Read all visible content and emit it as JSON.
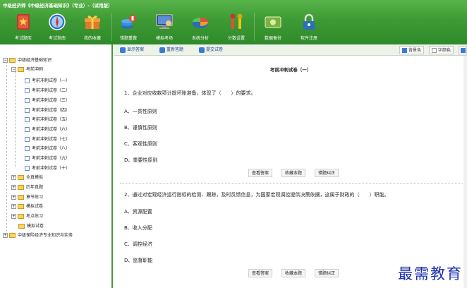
{
  "app": {
    "title": "中级经济师《中级经济基础知识》（专业）-（试用版）"
  },
  "toolbar": {
    "buttons": [
      {
        "label": "考试题库",
        "icon": "book-star-icon"
      },
      {
        "label": "考试指南",
        "icon": "compass-icon"
      },
      {
        "label": "我的收藏",
        "icon": "gift-icon"
      },
      {
        "label": "错题重做",
        "icon": "stack-icon"
      },
      {
        "label": "模拟考场",
        "icon": "computer-user-icon"
      },
      {
        "label": "系统分析",
        "icon": "pie-chart-icon"
      },
      {
        "label": "分数设置",
        "icon": "tools-icon"
      },
      {
        "label": "数据备份",
        "icon": "banknote-icon"
      },
      {
        "label": "软件注册",
        "icon": "lock-icon"
      }
    ]
  },
  "tree": {
    "root": "中级经济基础知识",
    "section": "考前冲刺",
    "papers": [
      "考前冲刺试卷（一）",
      "考前冲刺试卷（二）",
      "考前冲刺试卷（三）",
      "考前冲刺试卷（四）",
      "考前冲刺试卷（五）",
      "考前冲刺试卷（六）",
      "考前冲刺试卷（七）",
      "考前冲刺试卷（八）",
      "考前冲刺试卷（九）",
      "考前冲刺试卷（十）"
    ],
    "other_sections": [
      "全真模拟",
      "历年真题",
      "章节练习",
      "模拟试卷",
      "考点练习",
      "模拟试卷"
    ],
    "second_root": "中级保险经济专业知识与实务"
  },
  "main_toolbar": {
    "show_answer": "显示答案",
    "redo": "重新答题",
    "submit": "提交试卷",
    "bg_color": "背景色",
    "font_color": "字颜色"
  },
  "paper": {
    "title": "考前冲刺试卷（一）",
    "questions": [
      {
        "text": "1、企业对应收款项计提坏账准备，体现了（　　）的要求。",
        "options": [
          "A、一贯性原则",
          "B、谨慎性原则",
          "C、客观性原则",
          "D、重要性原则"
        ]
      },
      {
        "text": "2、通过对宏观经济运行指标的检测、跟踪，及时反馈信息，为国家宏观调控提供决策依据，这属于财政的（　　）职能。",
        "options": [
          "A、资源配置",
          "B、收入分配",
          "C、调控经济",
          "D、监督职能"
        ]
      }
    ],
    "actions": {
      "view_answer": "查看答案",
      "favorite": "收藏本题",
      "report_error": "错题纠正"
    }
  },
  "watermark": "最需教育",
  "colors": {
    "toolbar_green": "#3d9a34",
    "link_blue": "#1c3f8a",
    "watermark_blue": "#1a2fb0"
  }
}
